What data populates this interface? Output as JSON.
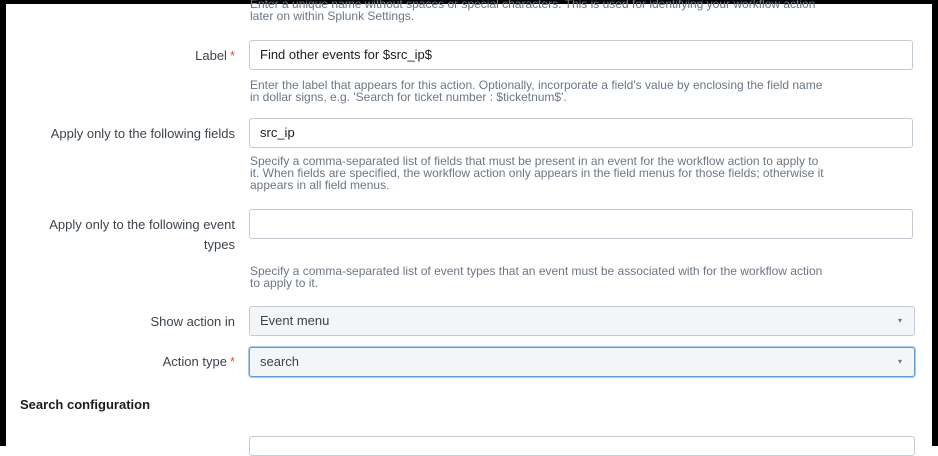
{
  "top_help": {
    "line1": "Enter a unique name without spaces or special characters. This is used for identifying your workflow action",
    "line2": "later on within Splunk Settings."
  },
  "fields": {
    "label": {
      "label": "Label",
      "required_mark": "*",
      "value": "Find other events for $src_ip$",
      "help_line1": "Enter the label that appears for this action. Optionally, incorporate a field's value by enclosing the field name",
      "help_line2": "in dollar signs, e.g. 'Search for ticket number : $ticketnum$'."
    },
    "apply_fields": {
      "label": "Apply only to the following fields",
      "value": "src_ip",
      "help_line1": "Specify a comma-separated list of fields that must be present in an event for the workflow action to apply to",
      "help_line2": "it. When fields are specified, the workflow action only appears in the field menus for those fields; otherwise it",
      "help_line3": "appears in all field menus."
    },
    "apply_event_types": {
      "label_line1": "Apply only to the following event",
      "label_line2": "types",
      "value": "",
      "help_line1": "Specify a comma-separated list of event types that an event must be associated with for the workflow action",
      "help_line2": "to apply to it."
    },
    "show_action_in": {
      "label": "Show action in",
      "value": "Event menu",
      "caret": "▾"
    },
    "action_type": {
      "label": "Action type",
      "required_mark": "*",
      "value": "search",
      "caret": "▾"
    }
  },
  "section": {
    "title": "Search configuration"
  },
  "colors": {
    "required": "#d6563c",
    "focus_border": "#5e9ed6",
    "help_text": "#6b7785"
  }
}
